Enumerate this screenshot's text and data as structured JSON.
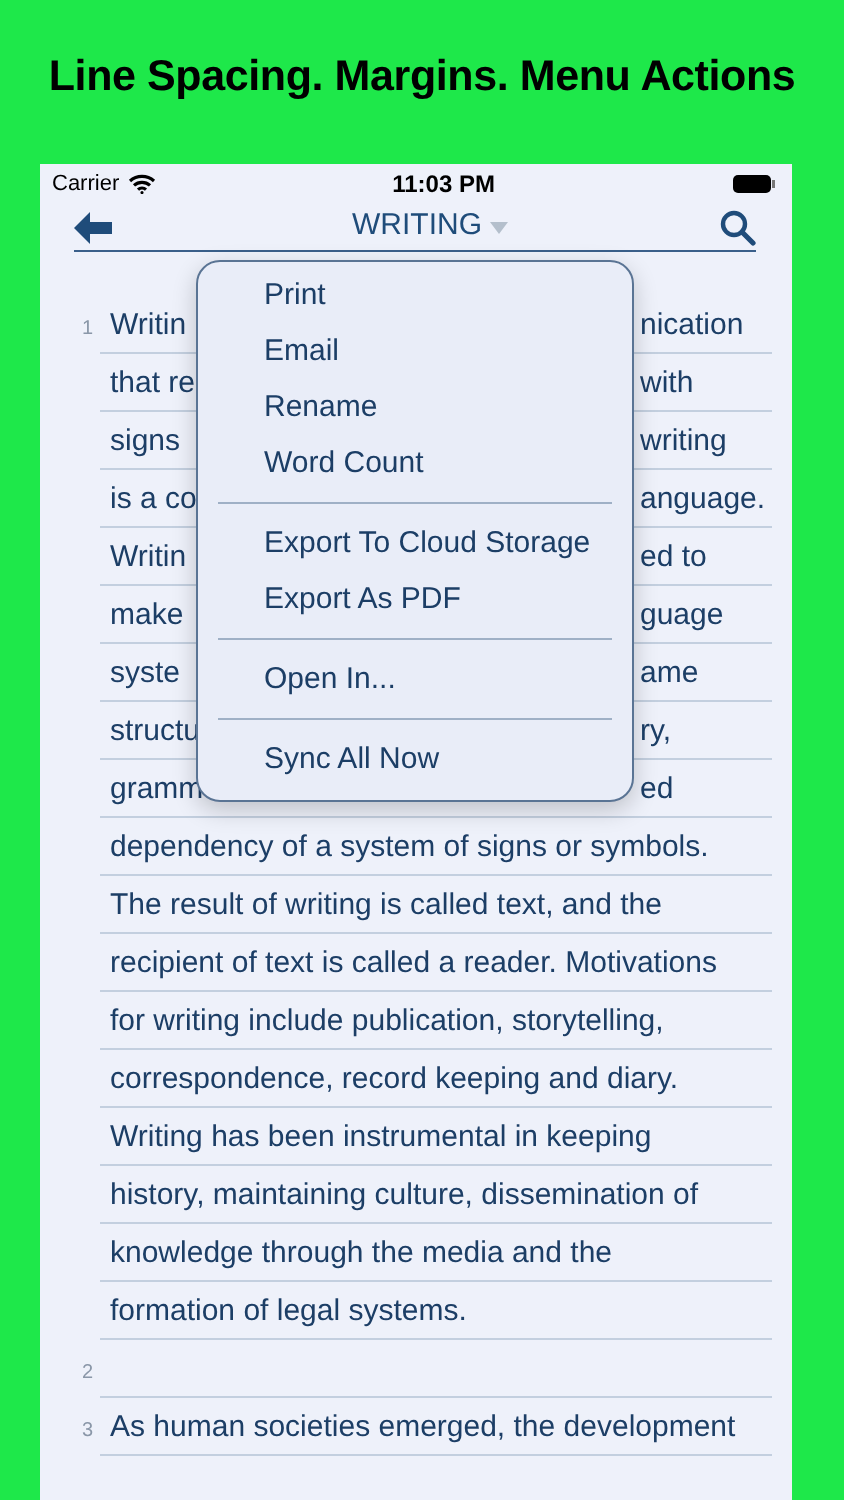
{
  "headline": "Line Spacing. Margins. Menu Actions",
  "status_bar": {
    "carrier": "Carrier",
    "time": "11:03 PM"
  },
  "nav": {
    "title": "WRITING"
  },
  "lines": [
    {
      "number": "1",
      "left": "Writin",
      "right": "nication"
    },
    {
      "left": "that re",
      "right": "with"
    },
    {
      "left": "signs",
      "right": "writing"
    },
    {
      "left": "is a co",
      "right": "anguage."
    },
    {
      "left": "Writin",
      "right": "ed to"
    },
    {
      "left": "make",
      "right": "guage"
    },
    {
      "left": "syste",
      "right": "ame"
    },
    {
      "left": "structu",
      "right": "ry,"
    },
    {
      "left": "gramm",
      "right": "ed"
    },
    {
      "text": "dependency of a system of signs or symbols."
    },
    {
      "text": "The result of writing is called text, and the"
    },
    {
      "text": "recipient of text is called a reader. Motivations"
    },
    {
      "text": "for writing include publication, storytelling,"
    },
    {
      "text": "correspondence, record keeping and diary."
    },
    {
      "text": "Writing has been instrumental in keeping"
    },
    {
      "text": "history, maintaining culture, dissemination of"
    },
    {
      "text": "knowledge through the media and the"
    },
    {
      "text": "formation of legal systems."
    },
    {
      "number": "2"
    },
    {
      "number": "3",
      "text": "As human societies emerged, the development"
    }
  ],
  "menu": [
    [
      "Print",
      "Email",
      "Rename",
      "Word Count"
    ],
    [
      "Export To Cloud Storage",
      "Export As PDF"
    ],
    [
      "Open In..."
    ],
    [
      "Sync All Now"
    ]
  ]
}
